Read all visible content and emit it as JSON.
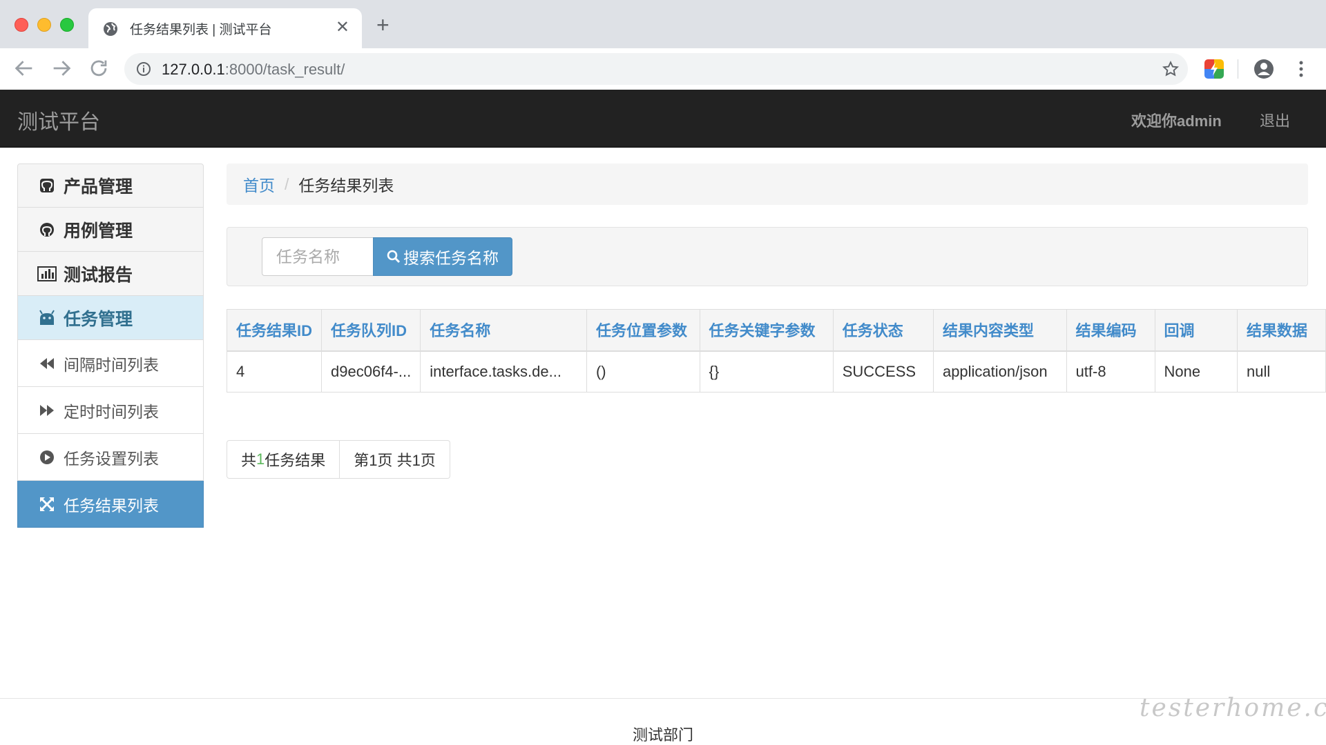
{
  "browser": {
    "tab_title": "任务结果列表 | 测试平台",
    "url_host": "127.0.0.1",
    "url_rest": ":8000/task_result/"
  },
  "app": {
    "brand": "测试平台",
    "welcome": "欢迎你admin",
    "logout": "退出"
  },
  "sidebar": {
    "items": [
      {
        "label": "产品管理",
        "icon": "github-square-icon"
      },
      {
        "label": "用例管理",
        "icon": "github-icon"
      },
      {
        "label": "测试报告",
        "icon": "bar-chart-icon"
      },
      {
        "label": "任务管理",
        "icon": "android-icon"
      }
    ],
    "subitems": [
      {
        "label": "间隔时间列表",
        "icon": "backward-icon"
      },
      {
        "label": "定时时间列表",
        "icon": "forward-icon"
      },
      {
        "label": "任务设置列表",
        "icon": "play-circle-icon"
      },
      {
        "label": "任务结果列表",
        "icon": "arrows-alt-icon"
      }
    ]
  },
  "breadcrumb": {
    "home": "首页",
    "separator": "/",
    "current": "任务结果列表"
  },
  "search": {
    "placeholder": "任务名称",
    "button_label": "搜索任务名称"
  },
  "table": {
    "headers": [
      "任务结果ID",
      "任务队列ID",
      "任务名称",
      "任务位置参数",
      "任务关键字参数",
      "任务状态",
      "结果内容类型",
      "结果编码",
      "回调",
      "结果数据"
    ],
    "rows": [
      [
        "4",
        "d9ec06f4-...",
        "interface.tasks.de...",
        "()",
        "{}",
        "SUCCESS",
        "application/json",
        "utf-8",
        "None",
        "null"
      ]
    ]
  },
  "pager": {
    "total_prefix": "共",
    "total_count": "1",
    "total_suffix": "任务结果",
    "page_info": "第1页 共1页"
  },
  "footer": {
    "text": "测试部门"
  },
  "watermark": "testerhome.com",
  "colors": {
    "navbar_bg": "#222222",
    "accent": "#5296c8",
    "link": "#428bca"
  }
}
